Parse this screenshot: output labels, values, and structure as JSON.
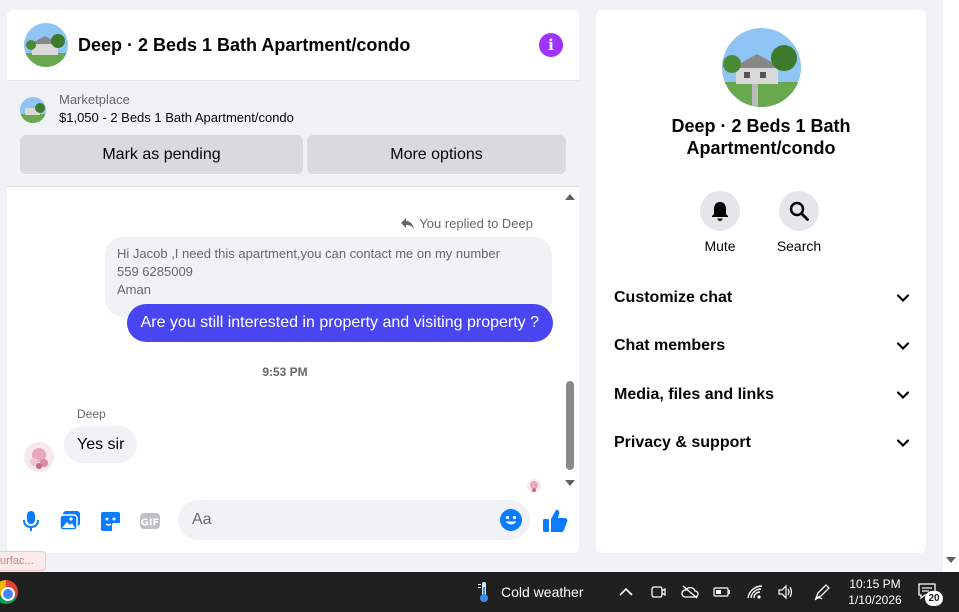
{
  "chat": {
    "title": "Deep · 2 Beds 1 Bath Apartment/condo",
    "marketplace_label": "Marketplace",
    "listing": "$1,050 - 2 Beds 1 Bath Apartment/condo",
    "buttons": {
      "pending": "Mark as pending",
      "more": "More options"
    },
    "replied_label": "You replied to Deep",
    "quoted_message": [
      "Hi Jacob ,I need this apartment,you can contact me on my number",
      "559 6285009",
      "Aman"
    ],
    "outgoing_message": "Are you still interested in property and visiting property ?",
    "timestamp": "9:53 PM",
    "sender_name": "Deep",
    "incoming_message": "Yes sir",
    "composer_placeholder": "Aa",
    "icons": [
      "microphone-icon",
      "photo-icon",
      "sticker-icon",
      "gif-icon",
      "emoji-icon",
      "thumbs-up-icon"
    ]
  },
  "info": {
    "name": "Deep · 2 Beds 1 Bath Apartment/condo",
    "actions": {
      "mute": "Mute",
      "search": "Search"
    },
    "sections": [
      "Customize chat",
      "Chat members",
      "Media, files and links",
      "Privacy & support"
    ]
  },
  "tooltip_text": "urfac...",
  "taskbar": {
    "weather": "Cold weather",
    "time": "10:15 PM",
    "date": "1/10/2026",
    "notification_count": "20"
  },
  "colors": {
    "accent": "#4946f1",
    "messenger_blue": "#0a7cff",
    "info_purple": "#a033ff"
  }
}
